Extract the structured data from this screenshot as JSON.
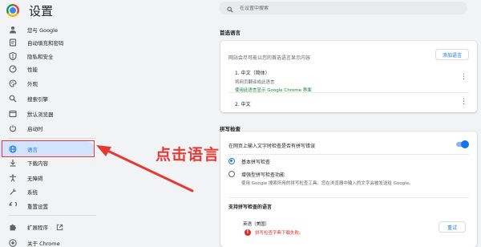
{
  "app": {
    "title": "设置"
  },
  "search": {
    "placeholder": "在设置中搜索"
  },
  "sidebar": {
    "items": [
      {
        "label": "您与 Google",
        "icon": "person-icon"
      },
      {
        "label": "自动填充和密码",
        "icon": "autofill-icon"
      },
      {
        "label": "隐私和安全",
        "icon": "shield-icon"
      },
      {
        "label": "性能",
        "icon": "performance-icon"
      },
      {
        "label": "外观",
        "icon": "palette-icon"
      },
      {
        "label": "搜索引擎",
        "icon": "search-icon"
      },
      {
        "label": "默认浏览器",
        "icon": "browser-icon"
      },
      {
        "label": "启动时",
        "icon": "power-icon"
      },
      {
        "label": "语言",
        "icon": "globe-icon"
      },
      {
        "label": "下载内容",
        "icon": "download-icon"
      },
      {
        "label": "无障碍",
        "icon": "accessibility-icon"
      },
      {
        "label": "系统",
        "icon": "wrench-icon"
      },
      {
        "label": "重置设置",
        "icon": "reset-icon"
      }
    ],
    "extensions_label": "扩展程序",
    "about_label": "关于 Chrome"
  },
  "preferred_languages": {
    "title": "首选语言",
    "description": "网站会尽可能以您的首选语言显示内容",
    "add_button": "添加语言",
    "languages": [
      {
        "name": "1. 中文（简体）",
        "sub": "将网页翻译成此语言",
        "ui_note": "使用此语言显示 Google Chrome 界面"
      },
      {
        "name": "2. 中文"
      }
    ]
  },
  "spell_check": {
    "title": "拼写检查",
    "toggle_label": "在网页上输入文字时检查是否有拼写错误",
    "toggle_on": true,
    "basic_label": "基本拼写检查",
    "enhanced_label": "增强型拼写检查功能",
    "enhanced_desc": "使用 Google 搜索所用的拼写检查工具。您在浏览器中输入的文字会被发送给 Google。",
    "languages_title": "支持拼写检查的语言",
    "dict_language": "英语（美国）",
    "dict_error": "拼写检查字典下载失败。",
    "retry_button": "重试"
  },
  "annotation": {
    "text": "点击语言"
  },
  "colors": {
    "accent": "#1a73e8",
    "annotation": "#e53935",
    "active_bg": "#d3e3fd",
    "error": "#d93025"
  }
}
